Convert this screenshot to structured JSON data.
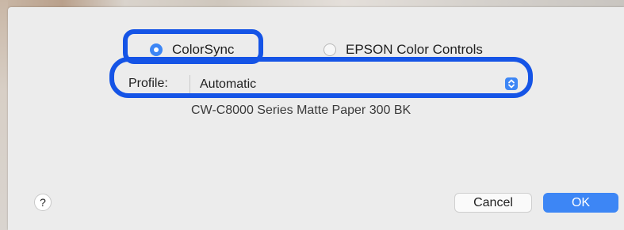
{
  "dialog": {
    "color_mode": {
      "options": [
        {
          "label": "ColorSync",
          "selected": true
        },
        {
          "label": "EPSON Color Controls",
          "selected": false
        }
      ]
    },
    "profile": {
      "label": "Profile:",
      "value": "Automatic"
    },
    "paper_description": "CW-C8000 Series Matte Paper 300 BK",
    "help_label": "?",
    "buttons": {
      "cancel": "Cancel",
      "ok": "OK"
    }
  },
  "colors": {
    "accent": "#3d86f5",
    "highlight_outline": "#1554e6",
    "dialog_background": "#ececec"
  }
}
